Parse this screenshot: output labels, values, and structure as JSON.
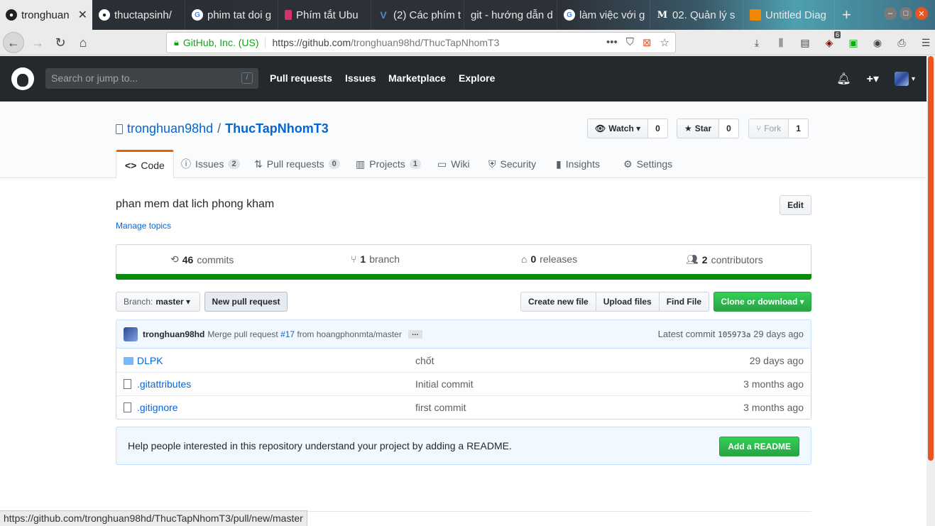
{
  "browser": {
    "tabs": [
      {
        "title": "tronghuan",
        "icon": "github-icon"
      },
      {
        "title": "thuctapsinh/",
        "icon": "github-icon"
      },
      {
        "title": "phim tat doi g",
        "icon": "google-icon"
      },
      {
        "title": "Phím tắt Ubu",
        "icon": "bookmark-icon"
      },
      {
        "title": "(2) Các phím t",
        "icon": "viblo-icon"
      },
      {
        "title": "git - hướng dẫn d",
        "icon": "blank-icon"
      },
      {
        "title": "làm việc với g",
        "icon": "google-icon"
      },
      {
        "title": "02. Quản lý s",
        "icon": "medium-icon"
      },
      {
        "title": "Untitled Diag",
        "icon": "drawio-icon"
      }
    ],
    "new_tab": "+",
    "identity": "GitHub, Inc. (US)",
    "url_host": "https://github.com",
    "url_path": "/tronghuan98hd/ThucTapNhomT3",
    "url_dots": "•••",
    "ublock_count": "6",
    "status_url": "https://github.com/tronghuan98hd/ThucTapNhomT3/pull/new/master"
  },
  "github": {
    "search_placeholder": "Search or jump to...",
    "search_key": "/",
    "nav": [
      "Pull requests",
      "Issues",
      "Marketplace",
      "Explore"
    ],
    "plus": "+▾"
  },
  "repo": {
    "owner": "tronghuan98hd",
    "separator": "/",
    "name": "ThucTapNhomT3",
    "watch_label": "Watch ▾",
    "watch_count": "0",
    "star_label": "Star",
    "star_count": "0",
    "fork_label": "Fork",
    "fork_count": "1",
    "tabs": [
      {
        "label": "Code",
        "badge": ""
      },
      {
        "label": "Issues",
        "badge": "2"
      },
      {
        "label": "Pull requests",
        "badge": "0"
      },
      {
        "label": "Projects",
        "badge": "1"
      },
      {
        "label": "Wiki",
        "badge": ""
      },
      {
        "label": "Security",
        "badge": ""
      },
      {
        "label": "Insights",
        "badge": ""
      },
      {
        "label": "Settings",
        "badge": ""
      }
    ],
    "description": "phan mem dat lich phong kham",
    "manage_topics": "Manage topics",
    "edit": "Edit",
    "summary": {
      "commits_n": "46",
      "commits_l": "commits",
      "branch_n": "1",
      "branch_l": "branch",
      "releases_n": "0",
      "releases_l": "releases",
      "contrib_n": "2",
      "contrib_l": "contributors"
    },
    "branch_prefix": "Branch:",
    "branch_name": "master ▾",
    "new_pr": "New pull request",
    "file_buttons": [
      "Create new file",
      "Upload files",
      "Find File"
    ],
    "clone": "Clone or download ▾",
    "commit": {
      "author": "tronghuan98hd",
      "msg_prefix": "Merge pull request ",
      "pr_link": "#17",
      "msg_suffix": " from hoangphonmta/master",
      "ellipsis": "…",
      "latest_label": "Latest commit",
      "sha": "105973a",
      "age": "29 days ago"
    },
    "files": [
      {
        "name": "DLPK",
        "type": "dir",
        "message": "chốt",
        "age": "29 days ago"
      },
      {
        "name": ".gitattributes",
        "type": "file",
        "message": "Initial commit",
        "age": "3 months ago"
      },
      {
        "name": ".gitignore",
        "type": "file",
        "message": "first commit",
        "age": "3 months ago"
      }
    ],
    "readme_prompt": "Help people interested in this repository understand your project by adding a README.",
    "add_readme": "Add a README"
  }
}
